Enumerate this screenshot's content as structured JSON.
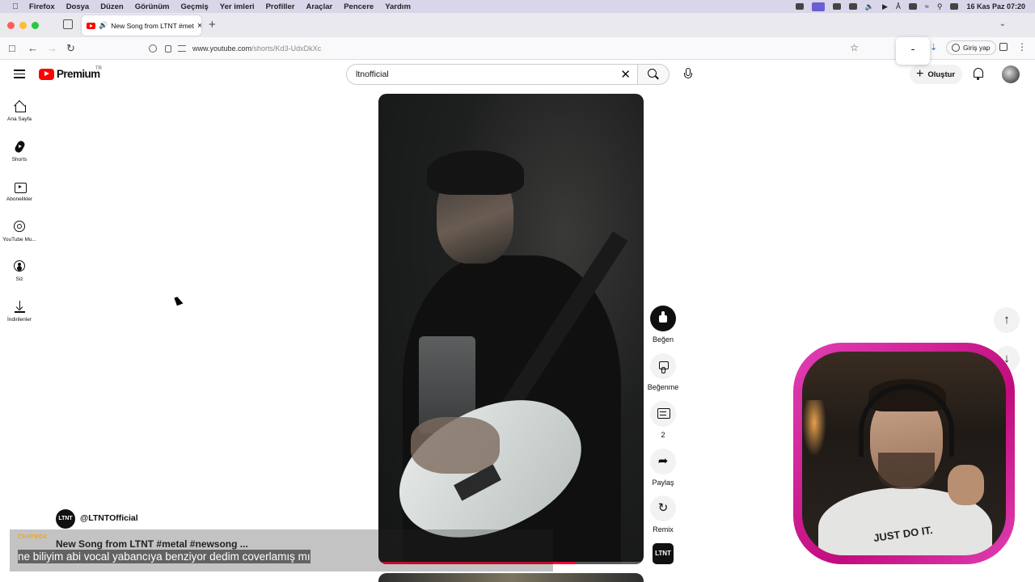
{
  "menubar": {
    "app": "Firefox",
    "menus": [
      "Dosya",
      "Düzen",
      "Görünüm",
      "Geçmiş",
      "Yer imleri",
      "Profiller",
      "Araçlar",
      "Pencere",
      "Yardım"
    ],
    "clock": "16 Kas Paz  07:20"
  },
  "browser": {
    "tab_title": "New Song from LTNT #met",
    "url_host": "www.youtube.com",
    "url_path": "/shorts/Kd3-UdxDkXc",
    "popup_text": "-",
    "signin_label": "Giriş yap"
  },
  "youtube": {
    "logo_text": "Premium",
    "region": "TR",
    "search_value": "ltnofficial",
    "create_label": "Oluştur"
  },
  "sidebar": {
    "items": [
      {
        "label": "Ana Sayfa",
        "icon": "home-icon"
      },
      {
        "label": "Shorts",
        "icon": "shorts-icon"
      },
      {
        "label": "Abonelikler",
        "icon": "subscriptions-icon"
      },
      {
        "label": "YouTube Mu...",
        "icon": "youtube-music-icon"
      },
      {
        "label": "Siz",
        "icon": "you-icon"
      },
      {
        "label": "İndirilenler",
        "icon": "downloads-icon"
      }
    ]
  },
  "short": {
    "channel": "@LTNTOfficial",
    "channel_avatar_text": "LTNT",
    "title": "New Song from LTNT #metal #newsong ...",
    "caption_tag": "CHATBOX",
    "subtitle": "ne biliyim abi vocal yabancıya benziyor dedim coverlamış mı",
    "progress": 0.74
  },
  "actions": {
    "like": "Beğen",
    "dislike": "Beğenme",
    "comments": "2",
    "share": "Paylaş",
    "remix": "Remix",
    "sound_text": "LTNT"
  },
  "webcam": {
    "shirt_text": "JUST DO IT."
  },
  "colors": {
    "brand_red": "#ff0000",
    "webcam_frame": "#d01f94"
  }
}
